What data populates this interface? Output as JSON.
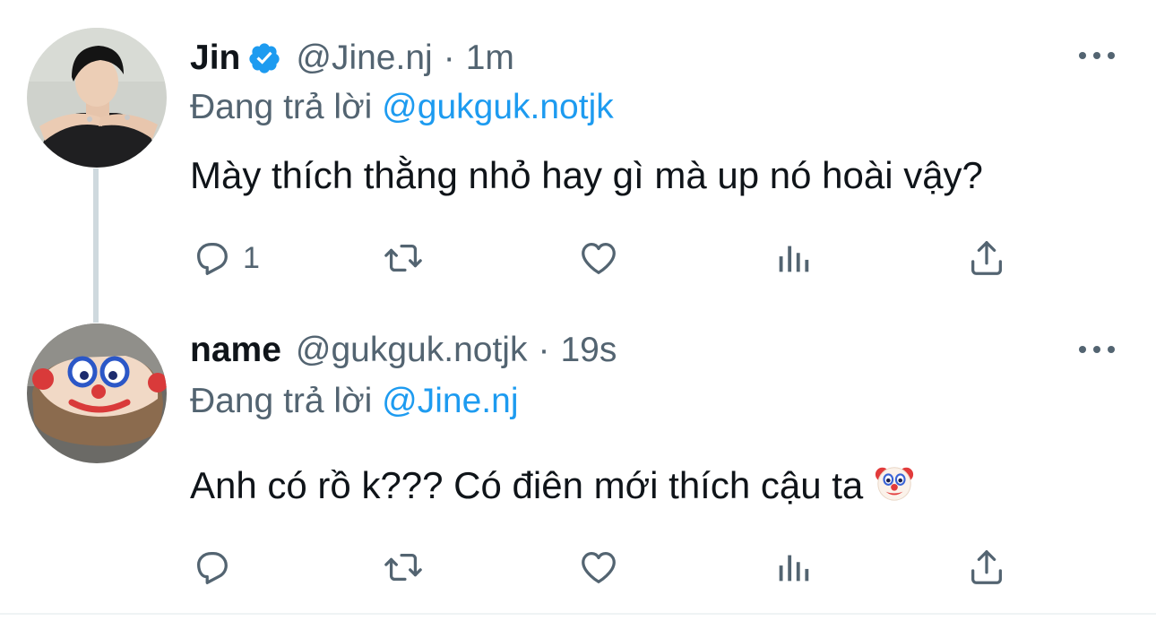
{
  "tweets": [
    {
      "author_name": "Jin",
      "verified": true,
      "handle": "@Jine.nj",
      "separator": "·",
      "time": "1m",
      "reply_prefix": "Đang trả lời",
      "reply_to": "@gukguk.notjk",
      "text": "Mày thích thằng nhỏ hay gì mà up nó hoài vậy?",
      "reply_count": "1",
      "avatar_icon": "profile-photo"
    },
    {
      "author_name": "name",
      "verified": false,
      "handle": "@gukguk.notjk",
      "separator": "·",
      "time": "19s",
      "reply_prefix": "Đang trả lời",
      "reply_to": "@Jine.nj",
      "text": "Anh có rồ k??? Có điên mới thích cậu ta",
      "emoji": "clown-face-emoji",
      "reply_count": "",
      "avatar_icon": "clown-cake-photo"
    }
  ],
  "icons": [
    "reply-icon",
    "retweet-icon",
    "like-icon",
    "views-icon",
    "share-icon",
    "more-icon",
    "verified-badge-icon"
  ],
  "colors": {
    "accent": "#1d9bf0",
    "text_primary": "#0f1419",
    "text_secondary": "#536471",
    "thread_line": "#cfd9de"
  }
}
